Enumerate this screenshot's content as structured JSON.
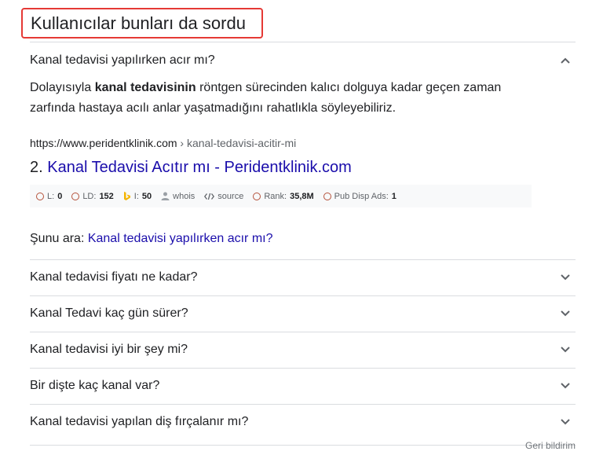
{
  "section": {
    "title": "Kullanıcılar bunları da sordu"
  },
  "expanded": {
    "question": "Kanal tedavisi yapılırken acır mı?",
    "answer_before": "Dolayısıyla ",
    "answer_bold": "kanal tedavisinin",
    "answer_after": " röntgen sürecinden kalıcı dolguya kadar geçen zaman zarfında hastaya acılı anlar yaşatmadığını rahatlıkla söyleyebiliriz.",
    "cite_domain": "https://www.peridentklinik.com",
    "cite_path": " › kanal-tedavisi-acitir-mi",
    "result_number": "2. ",
    "result_title": "Kanal Tedavisi Acıtır mı - Peridentklinik.com"
  },
  "seo_bar": {
    "l_label": "L:",
    "l_value": "0",
    "ld_label": "LD:",
    "ld_value": "152",
    "i_label": "I:",
    "i_value": "50",
    "whois": "whois",
    "source": "source",
    "rank_label": "Rank:",
    "rank_value": "35,8M",
    "pub_label": "Pub Disp Ads:",
    "pub_value": "1",
    "icon_color": "#b5533c",
    "bing_color": "#f4b400"
  },
  "search_for": {
    "label": "Şunu ara: ",
    "query": "Kanal tedavisi yapılırken acır mı?"
  },
  "questions": [
    "Kanal tedavisi fiyatı ne kadar?",
    "Kanal Tedavi kaç gün sürer?",
    "Kanal tedavisi iyi bir şey mi?",
    "Bir dişte kaç kanal var?",
    "Kanal tedavisi yapılan diş fırçalanır mı?"
  ],
  "footer": {
    "feedback": "Geri bildirim"
  },
  "colors": {
    "link": "#1a0dab",
    "highlight_border": "#e53935",
    "divider": "#dadce0"
  }
}
